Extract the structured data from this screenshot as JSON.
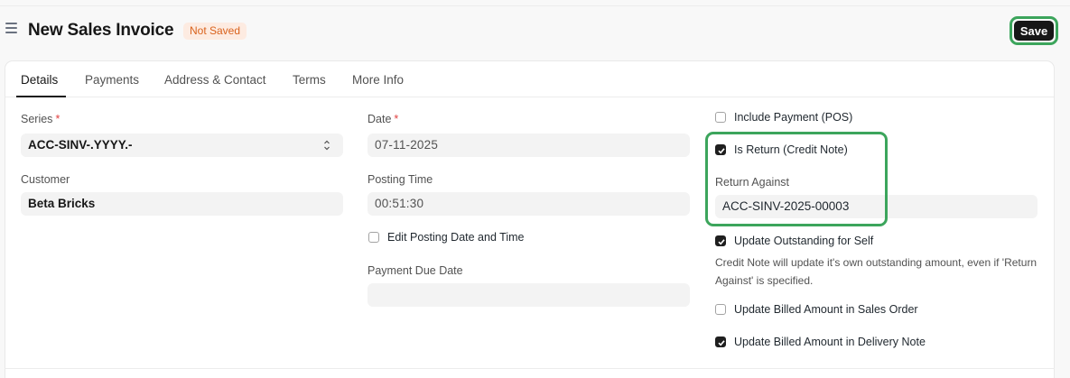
{
  "header": {
    "title": "New Sales Invoice",
    "status": "Not Saved",
    "save_label": "Save"
  },
  "tabs": [
    {
      "label": "Details",
      "active": true
    },
    {
      "label": "Payments"
    },
    {
      "label": "Address & Contact"
    },
    {
      "label": "Terms"
    },
    {
      "label": "More Info"
    }
  ],
  "left": {
    "series_label": "Series",
    "series_required": "*",
    "series_value": "ACC-SINV-.YYYY.-",
    "customer_label": "Customer",
    "customer_value": "Beta Bricks"
  },
  "middle": {
    "date_label": "Date",
    "date_required": "*",
    "date_value": "07-11-2025",
    "posting_time_label": "Posting Time",
    "posting_time_value": "00:51:30",
    "edit_posting_label": "Edit Posting Date and Time",
    "edit_posting_checked": false,
    "payment_due_label": "Payment Due Date",
    "payment_due_value": ""
  },
  "right": {
    "include_payment_label": "Include Payment (POS)",
    "include_payment_checked": false,
    "is_return_label": "Is Return (Credit Note)",
    "is_return_checked": true,
    "return_against_label": "Return Against",
    "return_against_value": "ACC-SINV-2025-00003",
    "update_outstanding_label": "Update Outstanding for Self",
    "update_outstanding_checked": true,
    "update_outstanding_desc": "Credit Note will update it's own outstanding amount, even if 'Return Against' is specified.",
    "update_billed_so_label": "Update Billed Amount in Sales Order",
    "update_billed_so_checked": false,
    "update_billed_dn_label": "Update Billed Amount in Delivery Note",
    "update_billed_dn_checked": true
  },
  "colors": {
    "highlight": "#3ca55c",
    "status_text": "#d9621c",
    "status_bg": "#fdebe1",
    "primary": "#171717"
  }
}
